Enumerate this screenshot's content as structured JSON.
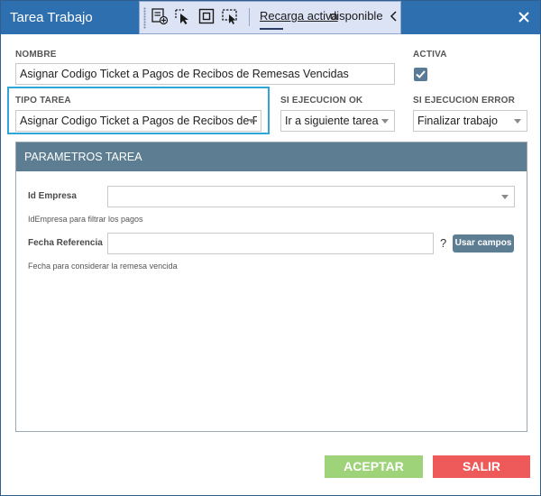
{
  "window": {
    "title": "Tarea Trabajo",
    "close_icon": "close-icon"
  },
  "floating_toolbar": {
    "icons": [
      "add-tab-icon",
      "pointer-select-icon",
      "frame-icon",
      "screen-capture-icon"
    ],
    "link_text": "Recarga activa",
    "status_text": "disponible",
    "collapse_icon": "chevron-left-icon"
  },
  "form": {
    "nombre": {
      "label": "NOMBRE",
      "value": "Asignar Codigo Ticket a Pagos de Recibos de Remesas Vencidas"
    },
    "activa": {
      "label": "ACTIVA",
      "checked": true
    },
    "tipo_tarea": {
      "label": "TIPO TAREA",
      "value": "Asignar Codigo Ticket a Pagos de Recibos de Remesas Vencidas"
    },
    "si_ejecucion_ok": {
      "label": "SI EJECUCION OK",
      "value": "Ir a siguiente tarea"
    },
    "si_ejecucion_error": {
      "label": "SI EJECUCION ERROR",
      "value": "Finalizar trabajo"
    }
  },
  "parametros": {
    "title": "PARAMETROS TAREA",
    "id_empresa": {
      "label": "Id Empresa",
      "value": "",
      "hint": "IdEmpresa para filtrar los pagos"
    },
    "fecha_referencia": {
      "label": "Fecha Referencia",
      "value": "",
      "hint": "Fecha para considerar la remesa vencida",
      "help": "?",
      "button": "Usar campos"
    }
  },
  "actions": {
    "accept": "ACEPTAR",
    "exit": "SALIR"
  },
  "colors": {
    "titlebar": "#2e6fb0",
    "panel_header": "#5d7d92",
    "accept_button": "#9ed37a",
    "exit_button": "#ee5a5a",
    "highlight_border": "#2ea6d8"
  }
}
